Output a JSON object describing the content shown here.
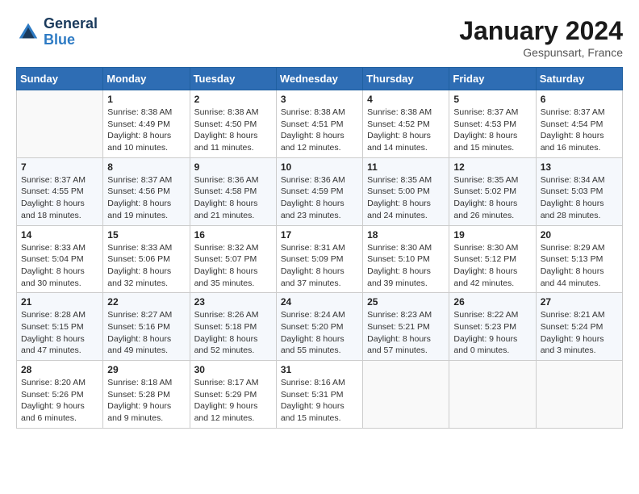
{
  "logo": {
    "line1": "General",
    "line2": "Blue"
  },
  "title": "January 2024",
  "subtitle": "Gespunsart, France",
  "days_header": [
    "Sunday",
    "Monday",
    "Tuesday",
    "Wednesday",
    "Thursday",
    "Friday",
    "Saturday"
  ],
  "weeks": [
    [
      {
        "num": "",
        "empty": true
      },
      {
        "num": "1",
        "sunrise": "Sunrise: 8:38 AM",
        "sunset": "Sunset: 4:49 PM",
        "daylight": "Daylight: 8 hours and 10 minutes."
      },
      {
        "num": "2",
        "sunrise": "Sunrise: 8:38 AM",
        "sunset": "Sunset: 4:50 PM",
        "daylight": "Daylight: 8 hours and 11 minutes."
      },
      {
        "num": "3",
        "sunrise": "Sunrise: 8:38 AM",
        "sunset": "Sunset: 4:51 PM",
        "daylight": "Daylight: 8 hours and 12 minutes."
      },
      {
        "num": "4",
        "sunrise": "Sunrise: 8:38 AM",
        "sunset": "Sunset: 4:52 PM",
        "daylight": "Daylight: 8 hours and 14 minutes."
      },
      {
        "num": "5",
        "sunrise": "Sunrise: 8:37 AM",
        "sunset": "Sunset: 4:53 PM",
        "daylight": "Daylight: 8 hours and 15 minutes."
      },
      {
        "num": "6",
        "sunrise": "Sunrise: 8:37 AM",
        "sunset": "Sunset: 4:54 PM",
        "daylight": "Daylight: 8 hours and 16 minutes."
      }
    ],
    [
      {
        "num": "7",
        "sunrise": "Sunrise: 8:37 AM",
        "sunset": "Sunset: 4:55 PM",
        "daylight": "Daylight: 8 hours and 18 minutes."
      },
      {
        "num": "8",
        "sunrise": "Sunrise: 8:37 AM",
        "sunset": "Sunset: 4:56 PM",
        "daylight": "Daylight: 8 hours and 19 minutes."
      },
      {
        "num": "9",
        "sunrise": "Sunrise: 8:36 AM",
        "sunset": "Sunset: 4:58 PM",
        "daylight": "Daylight: 8 hours and 21 minutes."
      },
      {
        "num": "10",
        "sunrise": "Sunrise: 8:36 AM",
        "sunset": "Sunset: 4:59 PM",
        "daylight": "Daylight: 8 hours and 23 minutes."
      },
      {
        "num": "11",
        "sunrise": "Sunrise: 8:35 AM",
        "sunset": "Sunset: 5:00 PM",
        "daylight": "Daylight: 8 hours and 24 minutes."
      },
      {
        "num": "12",
        "sunrise": "Sunrise: 8:35 AM",
        "sunset": "Sunset: 5:02 PM",
        "daylight": "Daylight: 8 hours and 26 minutes."
      },
      {
        "num": "13",
        "sunrise": "Sunrise: 8:34 AM",
        "sunset": "Sunset: 5:03 PM",
        "daylight": "Daylight: 8 hours and 28 minutes."
      }
    ],
    [
      {
        "num": "14",
        "sunrise": "Sunrise: 8:33 AM",
        "sunset": "Sunset: 5:04 PM",
        "daylight": "Daylight: 8 hours and 30 minutes."
      },
      {
        "num": "15",
        "sunrise": "Sunrise: 8:33 AM",
        "sunset": "Sunset: 5:06 PM",
        "daylight": "Daylight: 8 hours and 32 minutes."
      },
      {
        "num": "16",
        "sunrise": "Sunrise: 8:32 AM",
        "sunset": "Sunset: 5:07 PM",
        "daylight": "Daylight: 8 hours and 35 minutes."
      },
      {
        "num": "17",
        "sunrise": "Sunrise: 8:31 AM",
        "sunset": "Sunset: 5:09 PM",
        "daylight": "Daylight: 8 hours and 37 minutes."
      },
      {
        "num": "18",
        "sunrise": "Sunrise: 8:30 AM",
        "sunset": "Sunset: 5:10 PM",
        "daylight": "Daylight: 8 hours and 39 minutes."
      },
      {
        "num": "19",
        "sunrise": "Sunrise: 8:30 AM",
        "sunset": "Sunset: 5:12 PM",
        "daylight": "Daylight: 8 hours and 42 minutes."
      },
      {
        "num": "20",
        "sunrise": "Sunrise: 8:29 AM",
        "sunset": "Sunset: 5:13 PM",
        "daylight": "Daylight: 8 hours and 44 minutes."
      }
    ],
    [
      {
        "num": "21",
        "sunrise": "Sunrise: 8:28 AM",
        "sunset": "Sunset: 5:15 PM",
        "daylight": "Daylight: 8 hours and 47 minutes."
      },
      {
        "num": "22",
        "sunrise": "Sunrise: 8:27 AM",
        "sunset": "Sunset: 5:16 PM",
        "daylight": "Daylight: 8 hours and 49 minutes."
      },
      {
        "num": "23",
        "sunrise": "Sunrise: 8:26 AM",
        "sunset": "Sunset: 5:18 PM",
        "daylight": "Daylight: 8 hours and 52 minutes."
      },
      {
        "num": "24",
        "sunrise": "Sunrise: 8:24 AM",
        "sunset": "Sunset: 5:20 PM",
        "daylight": "Daylight: 8 hours and 55 minutes."
      },
      {
        "num": "25",
        "sunrise": "Sunrise: 8:23 AM",
        "sunset": "Sunset: 5:21 PM",
        "daylight": "Daylight: 8 hours and 57 minutes."
      },
      {
        "num": "26",
        "sunrise": "Sunrise: 8:22 AM",
        "sunset": "Sunset: 5:23 PM",
        "daylight": "Daylight: 9 hours and 0 minutes."
      },
      {
        "num": "27",
        "sunrise": "Sunrise: 8:21 AM",
        "sunset": "Sunset: 5:24 PM",
        "daylight": "Daylight: 9 hours and 3 minutes."
      }
    ],
    [
      {
        "num": "28",
        "sunrise": "Sunrise: 8:20 AM",
        "sunset": "Sunset: 5:26 PM",
        "daylight": "Daylight: 9 hours and 6 minutes."
      },
      {
        "num": "29",
        "sunrise": "Sunrise: 8:18 AM",
        "sunset": "Sunset: 5:28 PM",
        "daylight": "Daylight: 9 hours and 9 minutes."
      },
      {
        "num": "30",
        "sunrise": "Sunrise: 8:17 AM",
        "sunset": "Sunset: 5:29 PM",
        "daylight": "Daylight: 9 hours and 12 minutes."
      },
      {
        "num": "31",
        "sunrise": "Sunrise: 8:16 AM",
        "sunset": "Sunset: 5:31 PM",
        "daylight": "Daylight: 9 hours and 15 minutes."
      },
      {
        "num": "",
        "empty": true
      },
      {
        "num": "",
        "empty": true
      },
      {
        "num": "",
        "empty": true
      }
    ]
  ]
}
